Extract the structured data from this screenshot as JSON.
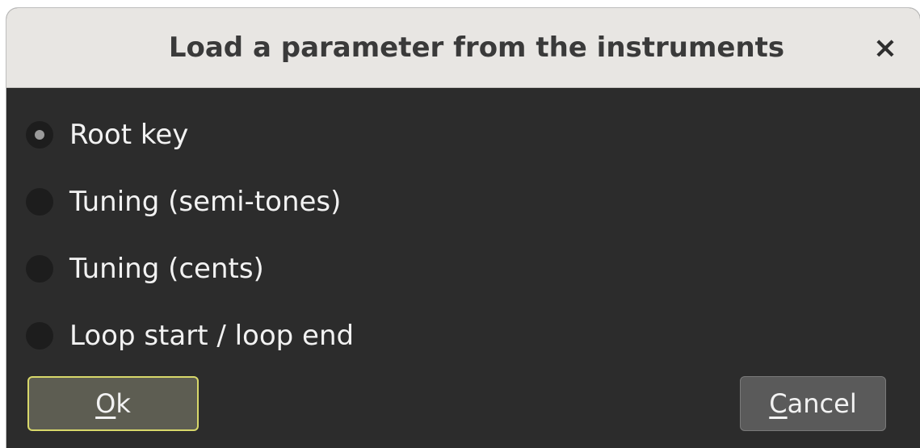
{
  "dialog": {
    "title": "Load a parameter from the instruments",
    "close_label": "×"
  },
  "options": [
    {
      "label": "Root key",
      "selected": true
    },
    {
      "label": "Tuning (semi-tones)",
      "selected": false
    },
    {
      "label": "Tuning (cents)",
      "selected": false
    },
    {
      "label": "Loop start / loop end",
      "selected": false
    }
  ],
  "buttons": {
    "ok": {
      "mnemonic": "O",
      "rest": "k"
    },
    "cancel": {
      "mnemonic": "C",
      "rest": "ancel"
    }
  },
  "colors": {
    "background": "#2c2c2c",
    "titlebar": "#e8e6e3",
    "ok_border": "#d8d86a"
  }
}
